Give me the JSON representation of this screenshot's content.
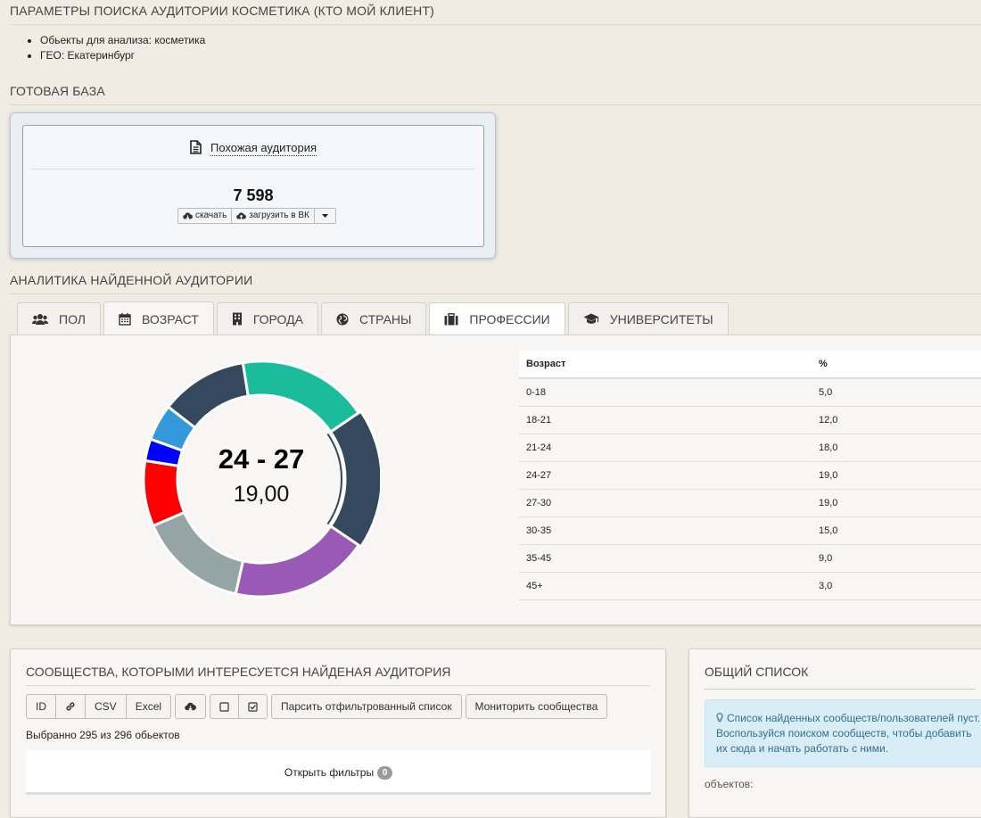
{
  "params": {
    "title": "ПАРАМЕТРЫ ПОИСКА АУДИТОРИИ КОСМЕТИКА (КТО МОЙ КЛИЕНТ)",
    "items": [
      "Обьекты для анализа: косметика",
      "ГЕО: Екатеринбург"
    ]
  },
  "base": {
    "title": "ГОТОВАЯ БАЗА",
    "link": "Похожая аудитория",
    "count": "7 598",
    "download": "скачать",
    "upload_vk": "загрузить в ВК"
  },
  "analytics": {
    "title": "АНАЛИТИКА НАЙДЕННОЙ АУДИТОРИИ",
    "tabs": [
      {
        "label": "ПОЛ",
        "icon": "users-icon"
      },
      {
        "label": "ВОЗРАСТ",
        "icon": "calendar-icon"
      },
      {
        "label": "ГОРОДА",
        "icon": "building-icon"
      },
      {
        "label": "СТРАНЫ",
        "icon": "globe-icon"
      },
      {
        "label": "ПРОФЕССИИ",
        "icon": "briefcase-icon"
      },
      {
        "label": "УНИВЕРСИТЕТЫ",
        "icon": "graduation-cap-icon"
      }
    ],
    "center_label": "24 - 27",
    "center_value": "19,00",
    "table": {
      "headers": [
        "Возраст",
        "%"
      ],
      "rows": [
        [
          "0-18",
          "5,0"
        ],
        [
          "18-21",
          "12,0"
        ],
        [
          "21-24",
          "18,0"
        ],
        [
          "24-27",
          "19,0"
        ],
        [
          "27-30",
          "19,0"
        ],
        [
          "30-35",
          "15,0"
        ],
        [
          "35-45",
          "9,0"
        ],
        [
          "45+",
          "3,0"
        ]
      ]
    }
  },
  "chart_data": {
    "type": "pie",
    "categories": [
      "0-18",
      "18-21",
      "21-24",
      "24-27",
      "27-30",
      "30-35",
      "35-45",
      "45+"
    ],
    "values": [
      5.0,
      12.0,
      18.0,
      19.0,
      19.0,
      15.0,
      9.0,
      3.0
    ],
    "colors": [
      "#3498db",
      "#34495e",
      "#1abc9c",
      "#34495e",
      "#9b59b6",
      "#95a5a6",
      "#ff0000",
      "#0000ff"
    ],
    "highlighted": "24-27"
  },
  "communities": {
    "title": "СООБЩЕСТВА, КОТОРЫМИ ИНТЕРЕСУЕТСЯ НАЙДЕНАЯ АУДИТОРИЯ",
    "btn_id": "ID",
    "btn_csv": "CSV",
    "btn_excel": "Excel",
    "btn_parse": "Парсить отфильтрованный список",
    "btn_monitor": "Мониторить сообщества",
    "selected": "Выбранно 295 из 296 обьектов",
    "filters": "Открыть фильтры",
    "filters_badge": "0"
  },
  "general_list": {
    "title": "ОБЩИЙ СПИСОК",
    "info": "Список найденных сообществ/пользователей пуст. Воспользуйся поиском сообществ, чтобы добавить их сюда и начать работать с ними.",
    "objects": "объектов:"
  }
}
